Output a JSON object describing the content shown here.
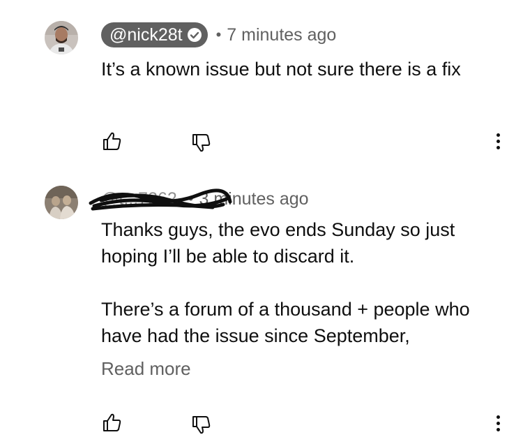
{
  "comments": [
    {
      "handle": "@nick28t",
      "verified": true,
      "separator": "•",
      "time": "7 minutes ago",
      "text": "It’s a known issue but not sure there is a fix",
      "avatar_icon": "user-avatar-icon",
      "like_icon": "thumbs-up-icon",
      "dislike_icon": "thumbs-down-icon",
      "menu_icon": "more-vert-icon"
    },
    {
      "handle": "@t...7262",
      "handle_redacted": true,
      "separator": "•",
      "time": "3 minutes ago",
      "text_p1": "Thanks guys, the evo ends Sunday so just hoping I’ll be able to discard it.",
      "text_p2": "There’s a forum of a thousand + people who have had the issue since September,",
      "read_more": "Read more",
      "avatar_icon": "user-avatar-icon",
      "like_icon": "thumbs-up-icon",
      "dislike_icon": "thumbs-down-icon",
      "menu_icon": "more-vert-icon"
    }
  ],
  "colors": {
    "text": "#0f0f0f",
    "secondary": "#606060",
    "chip_bg": "#606060",
    "background": "#ffffff"
  }
}
